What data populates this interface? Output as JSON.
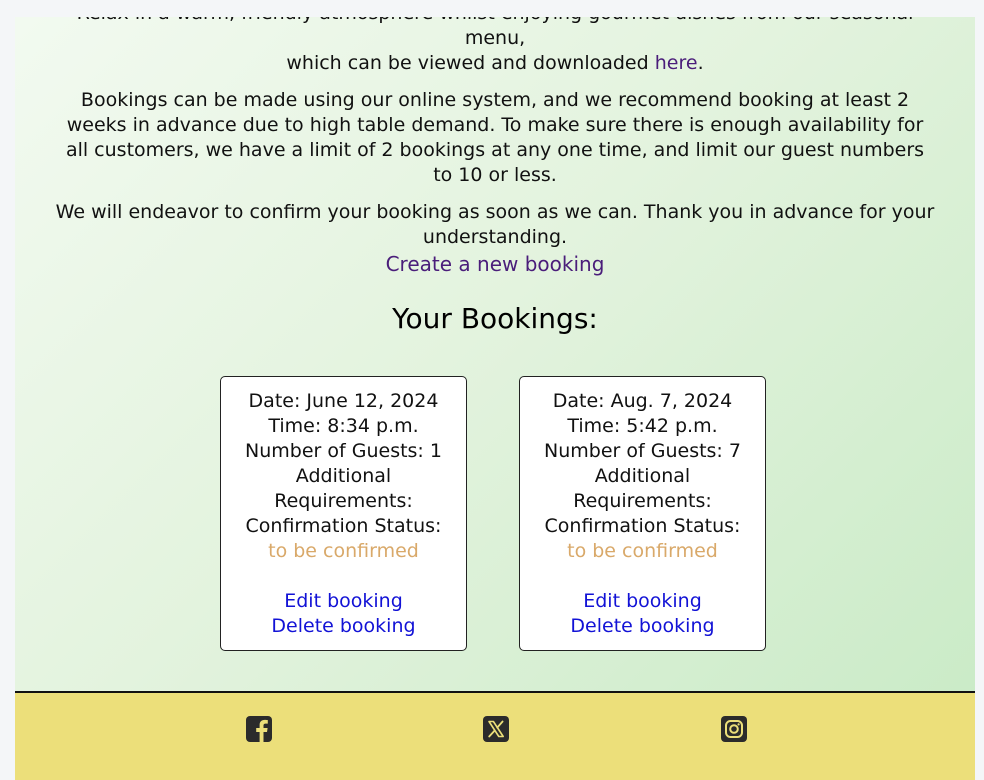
{
  "intro": {
    "line1_cut": "Relax in a warm, friendly atmosphere whilst enjoying gourmet dishes from our seasonal menu,",
    "line1_rest": "which can be viewed and downloaded",
    "menu_link": "here",
    "line1_end": ".",
    "paragraph2": "Bookings can be made using our online system, and we recommend booking at least 2 weeks in advance due to high table demand. To make sure there is enough availability for all customers, we have a limit of 2 bookings at any one time, and limit our guest numbers to 10 or less.",
    "paragraph3": "We will endeavor to confirm your booking as soon as we can. Thank you in advance for your understanding."
  },
  "create_link": "Create a new booking",
  "bookings_title": "Your Bookings:",
  "bookings": [
    {
      "date": "Date: June 12, 2024",
      "time": "Time: 8:34 p.m.",
      "guests": "Number of Guests: 1",
      "requirements": "Additional Requirements:",
      "status_label": "Confirmation Status:",
      "status_value": "to be confirmed",
      "edit": "Edit booking",
      "delete": "Delete booking"
    },
    {
      "date": "Date: Aug. 7, 2024",
      "time": "Time: 5:42 p.m.",
      "guests": "Number of Guests: 7",
      "requirements": "Additional Requirements:",
      "status_label": "Confirmation Status:",
      "status_value": "to be confirmed",
      "edit": "Edit booking",
      "delete": "Delete booking"
    }
  ],
  "footer": {
    "icons": [
      "facebook-icon",
      "x-twitter-icon",
      "instagram-icon"
    ]
  },
  "colors": {
    "link_purple": "#4a1d7a",
    "action_blue": "#1212d6",
    "status_tan": "#d9a96a",
    "footer_bg": "#ecdf7a"
  }
}
